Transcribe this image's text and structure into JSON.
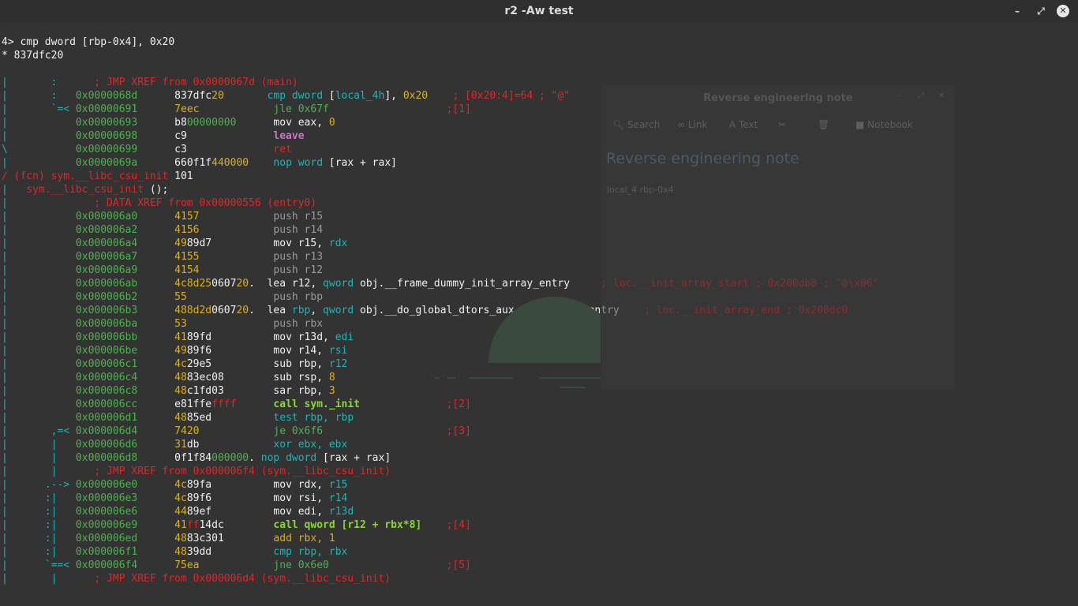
{
  "window": {
    "title": "r2 -Aw test",
    "minimize_glyph": "–",
    "maximize_glyph": "⤢",
    "close_glyph": "✕"
  },
  "terminal": {
    "lines": [
      [
        [
          "4> cmp dword [rbp-0x4], 0x20",
          "lt"
        ]
      ],
      [
        [
          "* 837dfc20",
          "lt"
        ]
      ],
      [],
      [
        [
          "|",
          "cy"
        ],
        [
          "       :      ",
          "cy"
        ],
        [
          "; JMP XREF from 0x0000067d (main)",
          "r"
        ]
      ],
      [
        [
          "|",
          "cy"
        ],
        [
          "       :   ",
          "cy"
        ],
        [
          "0x0000068d",
          "gr"
        ],
        [
          "      ",
          "lt"
        ],
        [
          "837dfc",
          "lt"
        ],
        [
          "20",
          "y"
        ],
        [
          "       ",
          "lt"
        ],
        [
          "cmp dword",
          "cy"
        ],
        [
          " [",
          "lt"
        ],
        [
          "local_4h",
          "cy"
        ],
        [
          "], ",
          "lt"
        ],
        [
          "0x20",
          "y"
        ],
        [
          "    ",
          "lt"
        ],
        [
          "; [0x20:4]=64 ; \"@\"",
          "r"
        ]
      ],
      [
        [
          "|",
          "cy"
        ],
        [
          "       `=< ",
          "cy"
        ],
        [
          "0x00000691",
          "gr"
        ],
        [
          "      ",
          "lt"
        ],
        [
          "7eec",
          "y"
        ],
        [
          "            ",
          "lt"
        ],
        [
          "jle 0x67f",
          "gr"
        ],
        [
          "                   ",
          "lt"
        ],
        [
          ";[1]",
          "r"
        ]
      ],
      [
        [
          "|",
          "cy"
        ],
        [
          "           ",
          "cy"
        ],
        [
          "0x00000693",
          "gr"
        ],
        [
          "      ",
          "lt"
        ],
        [
          "b8",
          "lt"
        ],
        [
          "00000000",
          "gr"
        ],
        [
          "      ",
          "lt"
        ],
        [
          "mov eax, ",
          "lt"
        ],
        [
          "0",
          "y"
        ]
      ],
      [
        [
          "|",
          "cy"
        ],
        [
          "           ",
          "cy"
        ],
        [
          "0x00000698",
          "gr"
        ],
        [
          "      ",
          "lt"
        ],
        [
          "c9",
          "lt"
        ],
        [
          "              ",
          "lt"
        ],
        [
          "leave",
          "m"
        ]
      ],
      [
        [
          "\\",
          "cy"
        ],
        [
          "           ",
          "cy"
        ],
        [
          "0x00000699",
          "gr"
        ],
        [
          "      ",
          "lt"
        ],
        [
          "c3",
          "lt"
        ],
        [
          "              ",
          "lt"
        ],
        [
          "ret",
          "r"
        ]
      ],
      [
        [
          "|",
          "cy"
        ],
        [
          "           ",
          "cy"
        ],
        [
          "0x0000069a",
          "gr"
        ],
        [
          "      ",
          "lt"
        ],
        [
          "660f1f",
          "lt"
        ],
        [
          "440000",
          "y"
        ],
        [
          "    ",
          "lt"
        ],
        [
          "nop word",
          "cy"
        ],
        [
          " [",
          "lt"
        ],
        [
          "rax",
          "lt"
        ],
        [
          " + ",
          "lt"
        ],
        [
          "rax",
          "lt"
        ],
        [
          "]",
          "lt"
        ]
      ],
      [
        [
          "/ (fcn) sym.__libc_csu_init",
          "r"
        ],
        [
          " 101",
          "lt"
        ]
      ],
      [
        [
          "|",
          "cy"
        ],
        [
          "   ",
          "lt"
        ],
        [
          "sym.__libc_csu_init",
          "r"
        ],
        [
          " ();",
          "lt"
        ]
      ],
      [
        [
          "|",
          "cy"
        ],
        [
          "              ",
          "lt"
        ],
        [
          "; DATA XREF from 0x00000556 (entry0)",
          "r"
        ]
      ],
      [
        [
          "|",
          "cy"
        ],
        [
          "           ",
          "lt"
        ],
        [
          "0x000006a0",
          "gr"
        ],
        [
          "      ",
          "lt"
        ],
        [
          "4157",
          "y"
        ],
        [
          "            ",
          "lt"
        ],
        [
          "push r15",
          "dim"
        ]
      ],
      [
        [
          "|",
          "cy"
        ],
        [
          "           ",
          "lt"
        ],
        [
          "0x000006a2",
          "gr"
        ],
        [
          "      ",
          "lt"
        ],
        [
          "4156",
          "y"
        ],
        [
          "            ",
          "lt"
        ],
        [
          "push r14",
          "dim"
        ]
      ],
      [
        [
          "|",
          "cy"
        ],
        [
          "           ",
          "lt"
        ],
        [
          "0x000006a4",
          "gr"
        ],
        [
          "      ",
          "lt"
        ],
        [
          "49",
          "y"
        ],
        [
          "89d7",
          "lt"
        ],
        [
          "          ",
          "lt"
        ],
        [
          "mov r15, ",
          "lt"
        ],
        [
          "rdx",
          "cy"
        ]
      ],
      [
        [
          "|",
          "cy"
        ],
        [
          "           ",
          "lt"
        ],
        [
          "0x000006a7",
          "gr"
        ],
        [
          "      ",
          "lt"
        ],
        [
          "4155",
          "y"
        ],
        [
          "            ",
          "lt"
        ],
        [
          "push r13",
          "dim"
        ]
      ],
      [
        [
          "|",
          "cy"
        ],
        [
          "           ",
          "lt"
        ],
        [
          "0x000006a9",
          "gr"
        ],
        [
          "      ",
          "lt"
        ],
        [
          "4154",
          "y"
        ],
        [
          "            ",
          "lt"
        ],
        [
          "push r12",
          "dim"
        ]
      ],
      [
        [
          "|",
          "cy"
        ],
        [
          "           ",
          "lt"
        ],
        [
          "0x000006ab",
          "gr"
        ],
        [
          "      ",
          "lt"
        ],
        [
          "4c8d",
          "y"
        ],
        [
          "25",
          "y"
        ],
        [
          "0607",
          "lt"
        ],
        [
          "20",
          "y"
        ],
        [
          ".",
          "lt"
        ],
        [
          "  ",
          "lt"
        ],
        [
          "lea r12, ",
          "lt"
        ],
        [
          "qword",
          "cy"
        ],
        [
          " obj.__frame_dummy_init_array_entry",
          "lt"
        ],
        [
          "     ",
          "lt"
        ],
        [
          "; loc.__init_array_start ; 0x200db8 ; \"@\\x06\"",
          "r"
        ]
      ],
      [
        [
          "|",
          "cy"
        ],
        [
          "           ",
          "lt"
        ],
        [
          "0x000006b2",
          "gr"
        ],
        [
          "      ",
          "lt"
        ],
        [
          "55",
          "y"
        ],
        [
          "              ",
          "lt"
        ],
        [
          "push rbp",
          "dim"
        ]
      ],
      [
        [
          "|",
          "cy"
        ],
        [
          "           ",
          "lt"
        ],
        [
          "0x000006b3",
          "gr"
        ],
        [
          "      ",
          "lt"
        ],
        [
          "488d",
          "y"
        ],
        [
          "2d",
          "y"
        ],
        [
          "0607",
          "lt"
        ],
        [
          "20",
          "y"
        ],
        [
          ".",
          "lt"
        ],
        [
          "  ",
          "lt"
        ],
        [
          "lea ",
          "lt"
        ],
        [
          "rbp",
          "cy"
        ],
        [
          ", ",
          "lt"
        ],
        [
          "qword",
          "cy"
        ],
        [
          " obj.__do_global_dtors_aux_fini_array_entry",
          "lt"
        ],
        [
          "    ",
          "lt"
        ],
        [
          "; loc.__init_array_end ; 0x200dc0",
          "r"
        ]
      ],
      [
        [
          "|",
          "cy"
        ],
        [
          "           ",
          "lt"
        ],
        [
          "0x000006ba",
          "gr"
        ],
        [
          "      ",
          "lt"
        ],
        [
          "53",
          "y"
        ],
        [
          "              ",
          "lt"
        ],
        [
          "push rbx",
          "dim"
        ]
      ],
      [
        [
          "|",
          "cy"
        ],
        [
          "           ",
          "lt"
        ],
        [
          "0x000006bb",
          "gr"
        ],
        [
          "      ",
          "lt"
        ],
        [
          "41",
          "y"
        ],
        [
          "89fd",
          "lt"
        ],
        [
          "          ",
          "lt"
        ],
        [
          "mov r13d, ",
          "lt"
        ],
        [
          "edi",
          "cy"
        ]
      ],
      [
        [
          "|",
          "cy"
        ],
        [
          "           ",
          "lt"
        ],
        [
          "0x000006be",
          "gr"
        ],
        [
          "      ",
          "lt"
        ],
        [
          "49",
          "y"
        ],
        [
          "89f6",
          "lt"
        ],
        [
          "          ",
          "lt"
        ],
        [
          "mov r14, ",
          "lt"
        ],
        [
          "rsi",
          "cy"
        ]
      ],
      [
        [
          "|",
          "cy"
        ],
        [
          "           ",
          "lt"
        ],
        [
          "0x000006c1",
          "gr"
        ],
        [
          "      ",
          "lt"
        ],
        [
          "4c",
          "y"
        ],
        [
          "29e5",
          "lt"
        ],
        [
          "          ",
          "lt"
        ],
        [
          "sub rbp, ",
          "lt"
        ],
        [
          "r12",
          "cy"
        ]
      ],
      [
        [
          "|",
          "cy"
        ],
        [
          "           ",
          "lt"
        ],
        [
          "0x000006c4",
          "gr"
        ],
        [
          "      ",
          "lt"
        ],
        [
          "48",
          "y"
        ],
        [
          "83ec08",
          "lt"
        ],
        [
          "        ",
          "lt"
        ],
        [
          "sub rsp, ",
          "lt"
        ],
        [
          "8",
          "y"
        ]
      ],
      [
        [
          "|",
          "cy"
        ],
        [
          "           ",
          "lt"
        ],
        [
          "0x000006c8",
          "gr"
        ],
        [
          "      ",
          "lt"
        ],
        [
          "48",
          "y"
        ],
        [
          "c1fd03",
          "lt"
        ],
        [
          "        ",
          "lt"
        ],
        [
          "sar rbp, ",
          "lt"
        ],
        [
          "3",
          "y"
        ]
      ],
      [
        [
          "|",
          "cy"
        ],
        [
          "           ",
          "lt"
        ],
        [
          "0x000006cc",
          "gr"
        ],
        [
          "      ",
          "lt"
        ],
        [
          "e81ffe",
          "lt"
        ],
        [
          "ffff",
          "r"
        ],
        [
          "      ",
          "lt"
        ],
        [
          "call sym._init",
          "lg"
        ],
        [
          "              ",
          "lt"
        ],
        [
          ";[2]",
          "r"
        ]
      ],
      [
        [
          "|",
          "cy"
        ],
        [
          "           ",
          "lt"
        ],
        [
          "0x000006d1",
          "gr"
        ],
        [
          "      ",
          "lt"
        ],
        [
          "48",
          "y"
        ],
        [
          "85ed",
          "lt"
        ],
        [
          "          ",
          "lt"
        ],
        [
          "test rbp, rbp",
          "cy"
        ]
      ],
      [
        [
          "|",
          "cy"
        ],
        [
          "       ,=< ",
          "cy"
        ],
        [
          "0x000006d4",
          "gr"
        ],
        [
          "      ",
          "lt"
        ],
        [
          "7420",
          "y"
        ],
        [
          "            ",
          "lt"
        ],
        [
          "je 0x6f6",
          "gr"
        ],
        [
          "                    ",
          "lt"
        ],
        [
          ";[3]",
          "r"
        ]
      ],
      [
        [
          "|",
          "cy"
        ],
        [
          "       |   ",
          "cy"
        ],
        [
          "0x000006d6",
          "gr"
        ],
        [
          "      ",
          "lt"
        ],
        [
          "31",
          "y"
        ],
        [
          "db",
          "lt"
        ],
        [
          "            ",
          "lt"
        ],
        [
          "xor ebx, ebx",
          "cy"
        ]
      ],
      [
        [
          "|",
          "cy"
        ],
        [
          "       |   ",
          "cy"
        ],
        [
          "0x000006d8",
          "gr"
        ],
        [
          "      ",
          "lt"
        ],
        [
          "0f1f84",
          "lt"
        ],
        [
          "000000",
          "gr"
        ],
        [
          ".",
          "lt"
        ],
        [
          " ",
          "lt"
        ],
        [
          "nop dword",
          "cy"
        ],
        [
          " [",
          "lt"
        ],
        [
          "rax",
          "lt"
        ],
        [
          " + ",
          "lt"
        ],
        [
          "rax",
          "lt"
        ],
        [
          "]",
          "lt"
        ]
      ],
      [
        [
          "|",
          "cy"
        ],
        [
          "       |      ",
          "cy"
        ],
        [
          "; JMP XREF from 0x000006f4 (sym.__libc_csu_init)",
          "r"
        ]
      ],
      [
        [
          "|",
          "cy"
        ],
        [
          "      .--> ",
          "cy"
        ],
        [
          "0x000006e0",
          "gr"
        ],
        [
          "      ",
          "lt"
        ],
        [
          "4c",
          "y"
        ],
        [
          "89fa",
          "lt"
        ],
        [
          "          ",
          "lt"
        ],
        [
          "mov rdx, ",
          "lt"
        ],
        [
          "r15",
          "cy"
        ]
      ],
      [
        [
          "|",
          "cy"
        ],
        [
          "      :|   ",
          "cy"
        ],
        [
          "0x000006e3",
          "gr"
        ],
        [
          "      ",
          "lt"
        ],
        [
          "4c",
          "y"
        ],
        [
          "89f6",
          "lt"
        ],
        [
          "          ",
          "lt"
        ],
        [
          "mov rsi, ",
          "lt"
        ],
        [
          "r14",
          "cy"
        ]
      ],
      [
        [
          "|",
          "cy"
        ],
        [
          "      :|   ",
          "cy"
        ],
        [
          "0x000006e6",
          "gr"
        ],
        [
          "      ",
          "lt"
        ],
        [
          "44",
          "y"
        ],
        [
          "89ef",
          "lt"
        ],
        [
          "          ",
          "lt"
        ],
        [
          "mov edi, ",
          "lt"
        ],
        [
          "r13d",
          "cy"
        ]
      ],
      [
        [
          "|",
          "cy"
        ],
        [
          "      :|   ",
          "cy"
        ],
        [
          "0x000006e9",
          "gr"
        ],
        [
          "      ",
          "lt"
        ],
        [
          "41",
          "y"
        ],
        [
          "ff",
          "r"
        ],
        [
          "14dc",
          "lt"
        ],
        [
          "        ",
          "lt"
        ],
        [
          "call qword [r12 + rbx*8]",
          "lg"
        ],
        [
          "    ",
          "lt"
        ],
        [
          ";[4]",
          "r"
        ]
      ],
      [
        [
          "|",
          "cy"
        ],
        [
          "      :|   ",
          "cy"
        ],
        [
          "0x000006ed",
          "gr"
        ],
        [
          "      ",
          "lt"
        ],
        [
          "48",
          "y"
        ],
        [
          "83c301",
          "lt"
        ],
        [
          "        ",
          "lt"
        ],
        [
          "add rbx, ",
          "y"
        ],
        [
          "1",
          "y"
        ]
      ],
      [
        [
          "|",
          "cy"
        ],
        [
          "      :|   ",
          "cy"
        ],
        [
          "0x000006f1",
          "gr"
        ],
        [
          "      ",
          "lt"
        ],
        [
          "48",
          "y"
        ],
        [
          "39dd",
          "lt"
        ],
        [
          "          ",
          "lt"
        ],
        [
          "cmp rbp, rbx",
          "cy"
        ]
      ],
      [
        [
          "|",
          "cy"
        ],
        [
          "      `==< ",
          "cy"
        ],
        [
          "0x000006f4",
          "gr"
        ],
        [
          "      ",
          "lt"
        ],
        [
          "75ea",
          "y"
        ],
        [
          "            ",
          "lt"
        ],
        [
          "jne 0x6e0",
          "gr"
        ],
        [
          "                   ",
          "lt"
        ],
        [
          ";[5]",
          "r"
        ]
      ],
      [
        [
          "|",
          "cy"
        ],
        [
          "       |      ",
          "cy"
        ],
        [
          "; JMP XREF from 0x000006d4 (sym.__libc_csu_init)",
          "r"
        ]
      ]
    ]
  },
  "note_window": {
    "title": "Reverse engineering note",
    "close_glyph": "✕",
    "toolbar": {
      "search": "Search",
      "link": "Link",
      "text": "Text",
      "notebook": "Notebook"
    },
    "heading": "Reverse engineering note",
    "body": "local_4 rbp-0x4"
  }
}
